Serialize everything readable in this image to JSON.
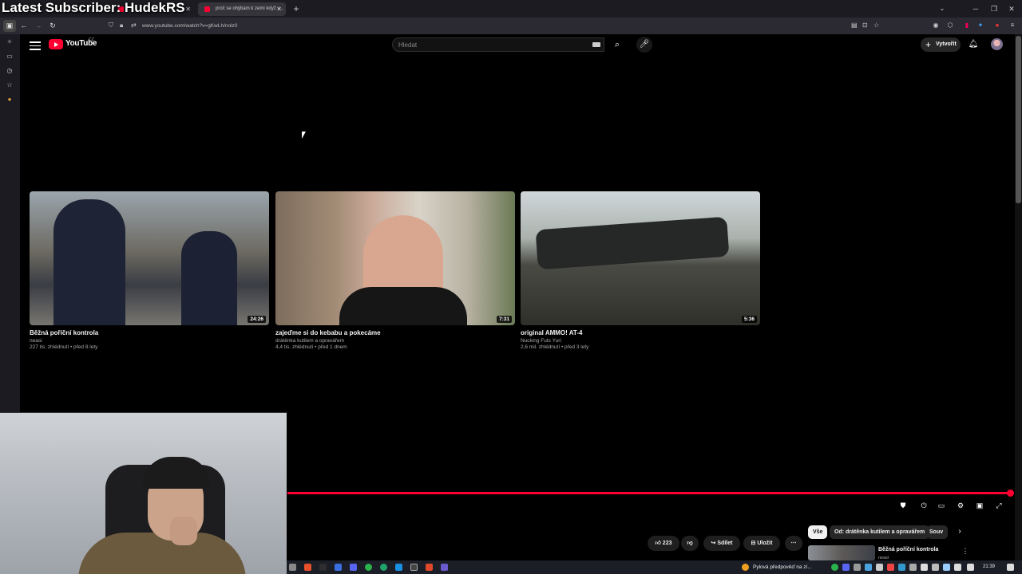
{
  "overlay": {
    "subscriber_text": "Latest Subscriber: HudekRS"
  },
  "browser": {
    "tabs": [
      {
        "title": "",
        "active": false
      },
      {
        "title": "proč se ohýbám k zemi když v...",
        "active": true
      }
    ],
    "new_tab_icon": "+",
    "url": "www.youtube.com/watch?v=gKwLh/nolz0",
    "window_controls": [
      "minimize-icon",
      "restore-icon",
      "close-icon"
    ]
  },
  "youtube": {
    "logo_text": "YouTube",
    "logo_country": "CZ",
    "search_placeholder": "Hledat",
    "create_label": "Vytvořit",
    "colors": {
      "brand_red": "#ff0033",
      "bg": "#000000",
      "chip_bg": "#272727"
    },
    "end_screen_videos": [
      {
        "title": "Běžná poříční kontrola",
        "channel": "neasi",
        "meta": "227 tis. zhlédnutí • před 8 lety",
        "duration": "24:26"
      },
      {
        "title": "zajeďme si do kebabu a pokecáme",
        "channel": "drátěnka kutilem a opravářem",
        "meta": "4,4 tis. zhlédnutí • před 1 dnem",
        "duration": "7:31"
      },
      {
        "title": "original AMMO! AT-4",
        "channel": "Nucking Futs Yuri",
        "meta": "2,6 mil. zhlédnutí • před 3 lety",
        "duration": "5:36"
      }
    ],
    "actions": {
      "likes": "223",
      "share": "Sdílet",
      "save": "Uložit"
    },
    "chips": [
      "Vše",
      "Od: drátěnka kutilem a opravářem",
      "Souv"
    ],
    "recommended": {
      "title": "Běžná poříční kontrola",
      "channel": "neasi"
    },
    "progress": 1.0
  },
  "taskbar": {
    "weather": "Pylová předpověď na zí...",
    "clock": "21:39"
  }
}
